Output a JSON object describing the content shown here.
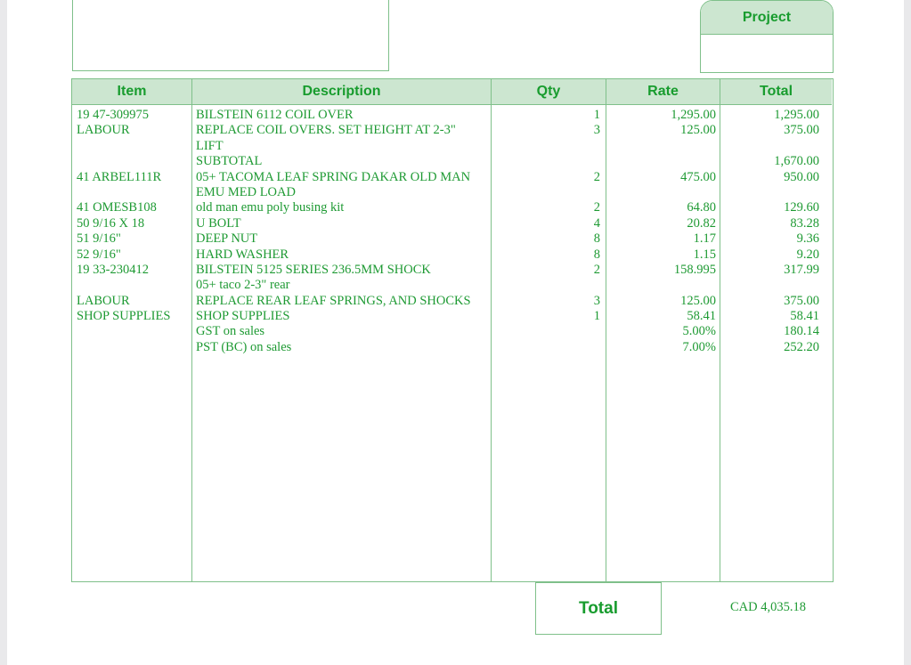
{
  "project_label": "Project",
  "headers": {
    "item": "Item",
    "description": "Description",
    "qty": "Qty",
    "rate": "Rate",
    "total": "Total"
  },
  "rows": [
    {
      "item": "19 47-309975",
      "description": "BILSTEIN 6112 COIL OVER",
      "qty": "1",
      "rate": "1,295.00",
      "total": "1,295.00"
    },
    {
      "item": "LABOUR",
      "description": "REPLACE COIL OVERS. SET HEIGHT AT 2-3\"",
      "qty": "3",
      "rate": "125.00",
      "total": "375.00"
    },
    {
      "item": "",
      "description": "LIFT",
      "qty": "",
      "rate": "",
      "total": ""
    },
    {
      "item": "",
      "description": "SUBTOTAL",
      "qty": "",
      "rate": "",
      "total": "1,670.00"
    },
    {
      "item": "41 ARBEL111R",
      "description": "05+ TACOMA LEAF SPRING DAKAR OLD MAN",
      "qty": "2",
      "rate": "475.00",
      "total": "950.00"
    },
    {
      "item": "",
      "description": "EMU MED LOAD",
      "qty": "",
      "rate": "",
      "total": ""
    },
    {
      "item": "41 OMESB108",
      "description": "old man emu poly busing kit",
      "qty": "2",
      "rate": "64.80",
      "total": "129.60"
    },
    {
      "item": "50 9/16 X 18",
      "description": "U BOLT",
      "qty": "4",
      "rate": "20.82",
      "total": "83.28"
    },
    {
      "item": "51 9/16\"",
      "description": "DEEP NUT",
      "qty": "8",
      "rate": "1.17",
      "total": "9.36"
    },
    {
      "item": "52 9/16\"",
      "description": "HARD WASHER",
      "qty": "8",
      "rate": "1.15",
      "total": "9.20"
    },
    {
      "item": "19 33-230412",
      "description": "BILSTEIN 5125 SERIES 236.5MM SHOCK",
      "qty": "2",
      "rate": "158.995",
      "total": "317.99"
    },
    {
      "item": "",
      "description": "05+ taco 2-3\" rear",
      "qty": "",
      "rate": "",
      "total": ""
    },
    {
      "item": "LABOUR",
      "description": "REPLACE REAR LEAF SPRINGS, AND SHOCKS",
      "qty": "3",
      "rate": "125.00",
      "total": "375.00"
    },
    {
      "item": "SHOP SUPPLIES",
      "description": "SHOP SUPPLIES",
      "qty": "1",
      "rate": "58.41",
      "total": "58.41"
    },
    {
      "item": "",
      "description": "GST on sales",
      "qty": "",
      "rate": "5.00%",
      "total": "180.14"
    },
    {
      "item": "",
      "description": "PST (BC) on sales",
      "qty": "",
      "rate": "7.00%",
      "total": "252.20"
    }
  ],
  "total_label": "Total",
  "grand_total": "CAD 4,035.18"
}
